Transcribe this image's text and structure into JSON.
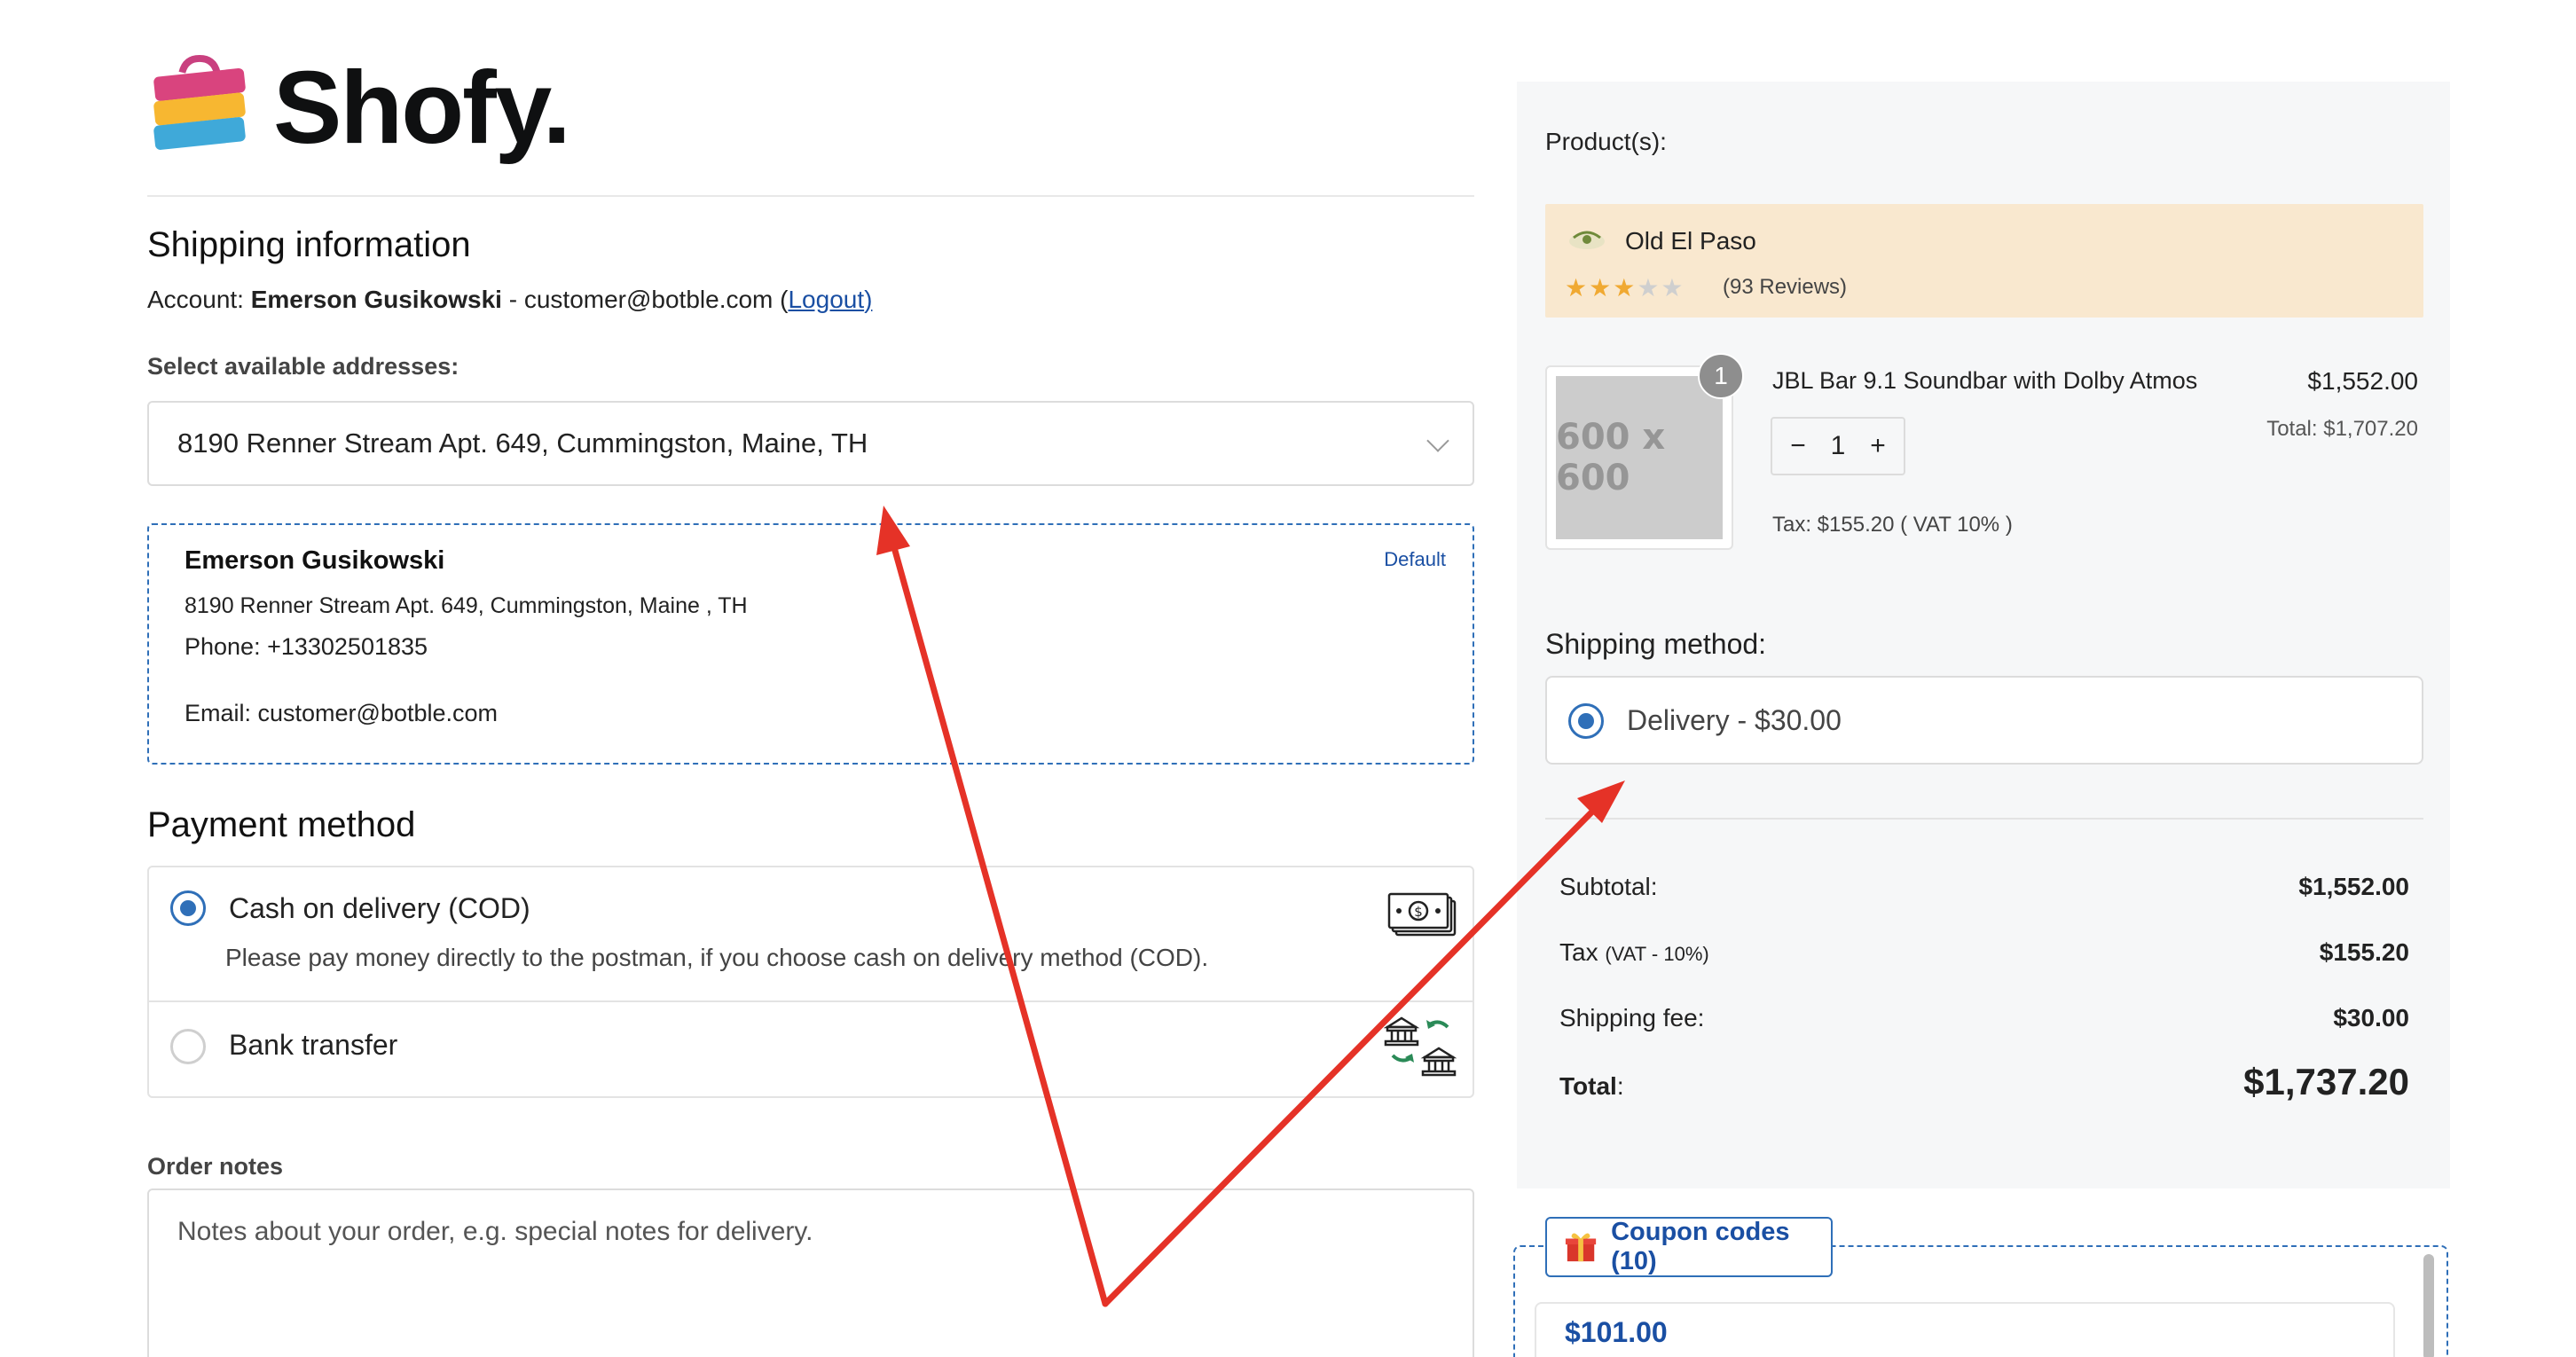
{
  "brand": {
    "name": "Shofy."
  },
  "shipping": {
    "title": "Shipping information",
    "account_prefix": "Account: ",
    "account_name": "Emerson Gusikowski",
    "account_email": " - customer@botble.com (",
    "logout": "Logout",
    "account_suffix": ")",
    "select_label": "Select available addresses:",
    "selected_address": "8190 Renner Stream Apt. 649, Cummingston, Maine, TH",
    "card": {
      "name": "Emerson Gusikowski",
      "address": "8190 Renner Stream Apt. 649, Cummingston, Maine , TH",
      "phone": "Phone: +13302501835",
      "email": "Email: customer@botble.com",
      "badge": "Default"
    }
  },
  "payment": {
    "title": "Payment method",
    "methods": [
      {
        "name": "Cash on delivery (COD)",
        "desc": "Please pay money directly to the postman, if you choose cash on delivery method (COD).",
        "selected": true,
        "icon": "cash-icon"
      },
      {
        "name": "Bank transfer",
        "desc": "",
        "selected": false,
        "icon": "bank-transfer-icon"
      }
    ]
  },
  "notes": {
    "label": "Order notes",
    "placeholder": "Notes about your order, e.g. special notes for delivery."
  },
  "order": {
    "products_label": "Product(s):",
    "store": {
      "name": "Old El Paso",
      "rating": 3,
      "reviews": "(93 Reviews)"
    },
    "item": {
      "image_text": "600 x 600",
      "qty_badge": "1",
      "name": "JBL Bar 9.1 Soundbar with Dolby Atmos",
      "price": "$1,552.00",
      "total": "Total: $1,707.20",
      "qty": "1",
      "tax": "Tax: $155.20 ( VAT 10% )"
    },
    "shipping_title": "Shipping method:",
    "shipping_option": "Delivery - $30.00",
    "summary": {
      "subtotal_label": "Subtotal:",
      "subtotal": "$1,552.00",
      "tax_label": "Tax",
      "tax_detail": "(VAT - 10%)",
      "tax": "$155.20",
      "fee_label": "Shipping fee:",
      "fee": "$30.00",
      "total_label": "Total",
      "total_colon": ":",
      "total": "$1,737.20"
    },
    "coupon": {
      "tab": "Coupon codes (10)",
      "first_amount": "$101.00"
    }
  },
  "colors": {
    "accent": "#2f6fb8",
    "link": "#1a4fa3",
    "store_bg": "#f9e8cf",
    "annotation": "#e53227"
  }
}
